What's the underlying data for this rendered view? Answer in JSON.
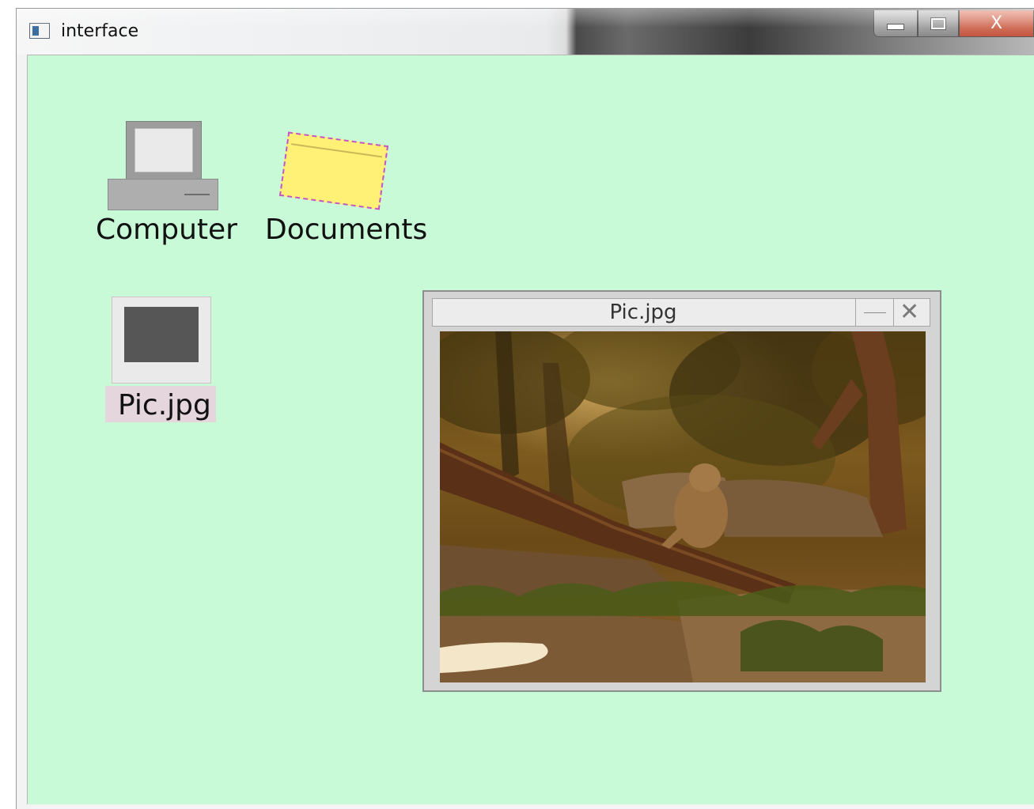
{
  "window": {
    "title": "interface",
    "controls": {
      "minimize": "minimize",
      "maximize": "maximize",
      "close": "X"
    }
  },
  "desktop": {
    "background_color": "#c8fad8",
    "icons": [
      {
        "label": "Computer",
        "icon": "computer-icon"
      },
      {
        "label": "Documents",
        "icon": "folder-icon"
      },
      {
        "label": "Pic.jpg",
        "icon": "image-file-icon"
      }
    ]
  },
  "viewer": {
    "title": "Pic.jpg",
    "minimize_glyph": "—",
    "close_glyph": "✕",
    "image_description_icon": "photo-bear-in-forest"
  }
}
